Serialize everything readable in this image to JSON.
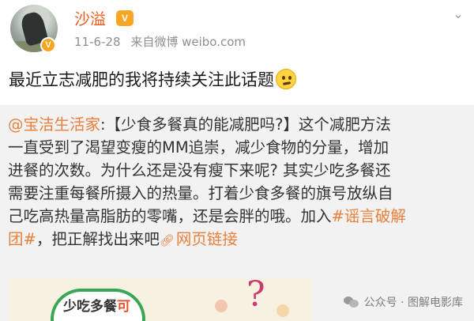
{
  "header": {
    "user_name": "沙溢",
    "vip_label": "V",
    "verify_label": "V",
    "time": "11-6-28",
    "source": "来自微博 weibo.com",
    "dropdown_icon": "chevron-down-icon"
  },
  "post": {
    "text": "最近立志减肥的我将持续关注此话题",
    "emoji": "thinking-face-icon"
  },
  "repost": {
    "lines": [
      {
        "prefix_link": "@宝洁生活家",
        "text": ":【少食多餐真的能减肥吗?】这个减肥方法"
      },
      {
        "text": "一直受到了渴望变瘦的MM追崇，减少食物的分量，增加"
      },
      {
        "text": "进餐的次数。为什么还是没有瘦下来呢? 其实少吃多餐还"
      },
      {
        "text": "需要注重每餐所摄入的热量。打着少食多餐的旗号放纵自"
      },
      {
        "text": "己吃高热量高脂肪的零嘴，还是会胖的哦。加入",
        "suffix_link": "#谣言破解"
      },
      {
        "prefix_link": "团#",
        "text": "，把正解找出来吧",
        "suffix_link": "网页链接"
      }
    ],
    "link_icon": "link-icon"
  },
  "preview": {
    "caption_pre": "少吃多餐",
    "caption_hl": "可",
    "question_mark": "?"
  },
  "watermark": {
    "label": "公众号 · 图解电影库",
    "icon": "wechat-icon"
  },
  "colors": {
    "name": "#f25b17",
    "link": "#e97f3a",
    "repost_bg": "#f2f2f2"
  }
}
